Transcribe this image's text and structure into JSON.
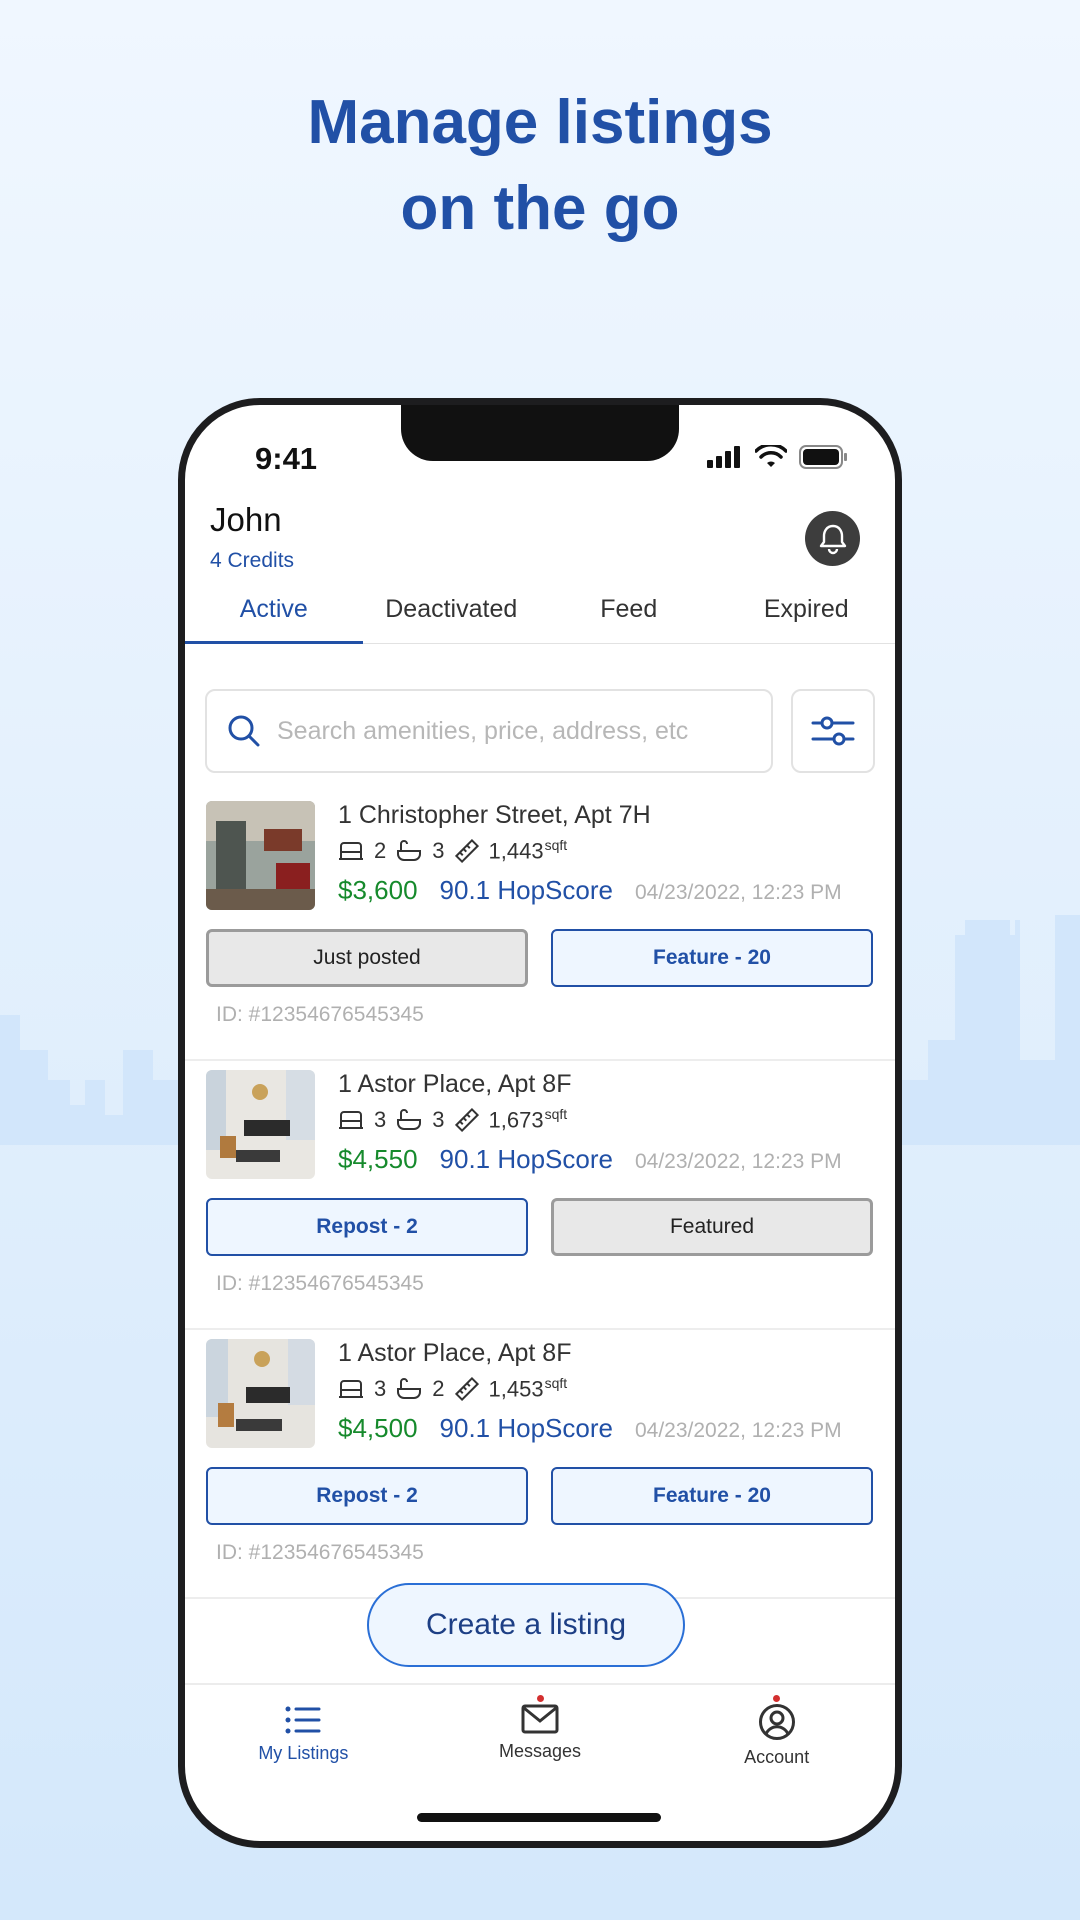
{
  "headline": {
    "line1": "Manage listings",
    "line2": "on the go"
  },
  "status": {
    "time": "9:41"
  },
  "user": {
    "name": "John",
    "credits": "4 Credits"
  },
  "tabs": [
    {
      "label": "Active"
    },
    {
      "label": "Deactivated"
    },
    {
      "label": "Feed"
    },
    {
      "label": "Expired"
    }
  ],
  "search": {
    "placeholder": "Search amenities, price, address, etc",
    "value": ""
  },
  "listings": [
    {
      "address": "1 Christopher Street, Apt 7H",
      "beds": "2",
      "baths": "3",
      "sqft": "1,443",
      "sqft_unit": "sqft",
      "price": "$3,600",
      "hopscore": "90.1 HopScore",
      "date": "04/23/2022, 12:23 PM",
      "button1": "Just posted",
      "button2": "Feature - 20",
      "id": "ID: #12354676545345"
    },
    {
      "address": "1 Astor Place, Apt 8F",
      "beds": "3",
      "baths": "3",
      "sqft": "1,673",
      "sqft_unit": "sqft",
      "price": "$4,550",
      "hopscore": "90.1 HopScore",
      "date": "04/23/2022, 12:23 PM",
      "button1": "Repost - 2",
      "button2": "Featured",
      "id": "ID: #12354676545345"
    },
    {
      "address": "1 Astor Place, Apt 8F",
      "beds": "3",
      "baths": "2",
      "sqft": "1,453",
      "sqft_unit": "sqft",
      "price": "$4,500",
      "hopscore": "90.1 HopScore",
      "date": "04/23/2022, 12:23 PM",
      "button1": "Repost - 2",
      "button2": "Feature - 20",
      "id": "ID: #12354676545345"
    }
  ],
  "create_button": "Create a listing",
  "nav": [
    {
      "label": "My Listings"
    },
    {
      "label": "Messages"
    },
    {
      "label": "Account"
    }
  ],
  "colors": {
    "primary": "#2150a6",
    "price": "#168a2c",
    "badge": "#d32f2f"
  }
}
